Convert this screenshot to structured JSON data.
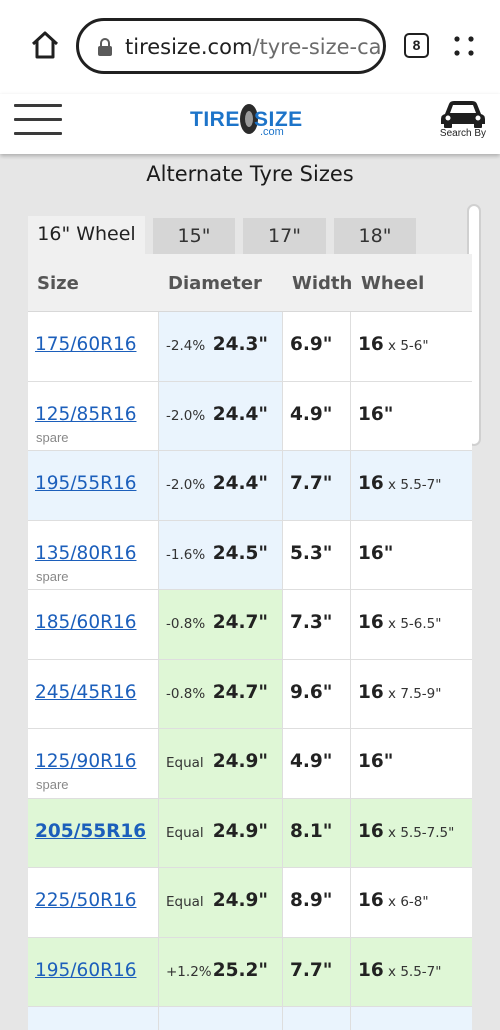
{
  "browser": {
    "url_domain": "tiresize.com",
    "url_path": "/tyre-size-ca",
    "tab_count": "8"
  },
  "header": {
    "logo_tire": "TIRE",
    "logo_size": "SIZE",
    "logo_com": ".com",
    "search_label": "Search By"
  },
  "page": {
    "title": "Alternate Tyre Sizes"
  },
  "tabs": [
    {
      "label": "16\" Wheel",
      "active": true
    },
    {
      "label": "15\"",
      "active": false
    },
    {
      "label": "17\"",
      "active": false
    },
    {
      "label": "18\"",
      "active": false
    }
  ],
  "table": {
    "headers": {
      "size": "Size",
      "diameter": "Diameter",
      "width": "Width",
      "wheel": "Wheel"
    },
    "rows": [
      {
        "size": "175/60R16",
        "note": "",
        "pct": "-2.4%",
        "diameter": "24.3\"",
        "width": "6.9\"",
        "wheel": "16",
        "range": " x 5-6\"",
        "highlight": "blue",
        "bold": false
      },
      {
        "size": "125/85R16",
        "note": "spare",
        "pct": "-2.0%",
        "diameter": "24.4\"",
        "width": "4.9\"",
        "wheel": "16\"",
        "range": "",
        "highlight": "blue",
        "bold": false
      },
      {
        "size": "195/55R16",
        "note": "",
        "pct": "-2.0%",
        "diameter": "24.4\"",
        "width": "7.7\"",
        "wheel": "16",
        "range": " x 5.5-7\"",
        "highlight": "blue-full",
        "bold": false
      },
      {
        "size": "135/80R16",
        "note": "spare",
        "pct": "-1.6%",
        "diameter": "24.5\"",
        "width": "5.3\"",
        "wheel": "16\"",
        "range": "",
        "highlight": "blue",
        "bold": false
      },
      {
        "size": "185/60R16",
        "note": "",
        "pct": "-0.8%",
        "diameter": "24.7\"",
        "width": "7.3\"",
        "wheel": "16",
        "range": " x 5-6.5\"",
        "highlight": "green",
        "bold": false
      },
      {
        "size": "245/45R16",
        "note": "",
        "pct": "-0.8%",
        "diameter": "24.7\"",
        "width": "9.6\"",
        "wheel": "16",
        "range": " x 7.5-9\"",
        "highlight": "green",
        "bold": false
      },
      {
        "size": "125/90R16",
        "note": "spare",
        "pct": "Equal",
        "diameter": "24.9\"",
        "width": "4.9\"",
        "wheel": "16\"",
        "range": "",
        "highlight": "green",
        "bold": false
      },
      {
        "size": "205/55R16",
        "note": "",
        "pct": "Equal",
        "diameter": "24.9\"",
        "width": "8.1\"",
        "wheel": "16",
        "range": " x 5.5-7.5\"",
        "highlight": "green-full",
        "bold": true
      },
      {
        "size": "225/50R16",
        "note": "",
        "pct": "Equal",
        "diameter": "24.9\"",
        "width": "8.9\"",
        "wheel": "16",
        "range": " x 6-8\"",
        "highlight": "green",
        "bold": false
      },
      {
        "size": "195/60R16",
        "note": "",
        "pct": "+1.2%",
        "diameter": "25.2\"",
        "width": "7.7\"",
        "wheel": "16",
        "range": " x 5.5-7\"",
        "highlight": "green-full",
        "bold": false
      },
      {
        "size": "",
        "note": "",
        "pct": "",
        "diameter": "",
        "width": "",
        "wheel": "",
        "range": "",
        "highlight": "blue-full",
        "bold": false
      }
    ]
  },
  "colors": {
    "link": "#1c5fbb",
    "logo": "#1d74c9",
    "blue_highlight": "#eaf4fd",
    "green_highlight": "#dff7d6"
  }
}
